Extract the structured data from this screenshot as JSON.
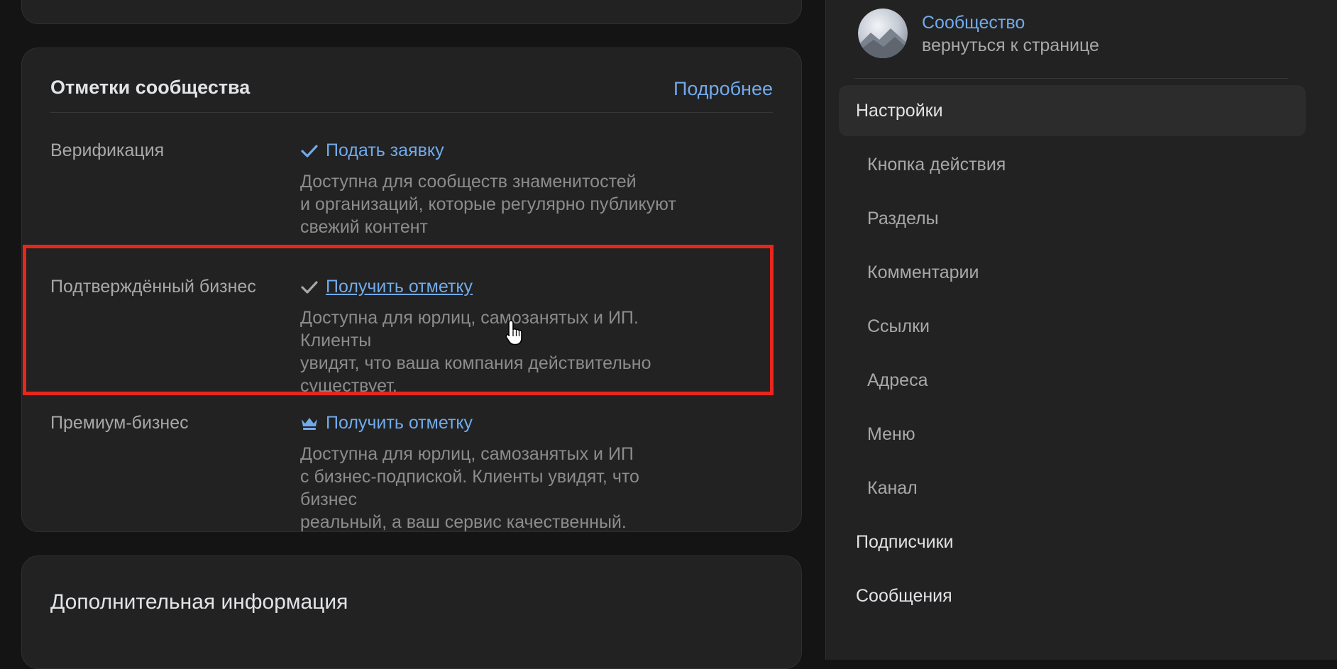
{
  "marks": {
    "title": "Отметки сообщества",
    "more_link": "Подробнее",
    "rows": [
      {
        "label": "Верификация",
        "icon": "checkmark-icon",
        "action": "Подать заявку",
        "description_lines": [
          "Доступна для сообществ знаменитостей",
          "и организаций, которые регулярно публикуют",
          "свежий контент"
        ]
      },
      {
        "label": "Подтверждённый бизнес",
        "icon": "checkmark-icon",
        "action": "Получить отметку",
        "description_lines": [
          "Доступна для юрлиц, самозанятых и ИП. Клиенты",
          "увидят, что ваша компания действительно",
          "существует."
        ]
      },
      {
        "label": "Премиум-бизнес",
        "icon": "crown-icon",
        "action": "Получить отметку",
        "description_lines": [
          "Доступна для юрлиц, самозанятых и ИП",
          "с бизнес-подпиской. Клиенты увидят, что бизнес",
          "реальный, а ваш сервис качественный."
        ]
      }
    ]
  },
  "extra": {
    "title": "Дополнительная информация"
  },
  "sidebar": {
    "community_name": "Сообщество",
    "back_link": "вернуться к странице",
    "items": [
      {
        "label": "Настройки",
        "level": "top",
        "active": true
      },
      {
        "label": "Кнопка действия",
        "level": "sub"
      },
      {
        "label": "Разделы",
        "level": "sub"
      },
      {
        "label": "Комментарии",
        "level": "sub"
      },
      {
        "label": "Ссылки",
        "level": "sub"
      },
      {
        "label": "Адреса",
        "level": "sub"
      },
      {
        "label": "Меню",
        "level": "sub"
      },
      {
        "label": "Канал",
        "level": "sub"
      },
      {
        "label": "Подписчики",
        "level": "top"
      },
      {
        "label": "Сообщения",
        "level": "top"
      }
    ]
  },
  "colors": {
    "accent": "#71aaeb",
    "highlight": "#e8261c",
    "background": "#141414",
    "card": "#222222"
  }
}
